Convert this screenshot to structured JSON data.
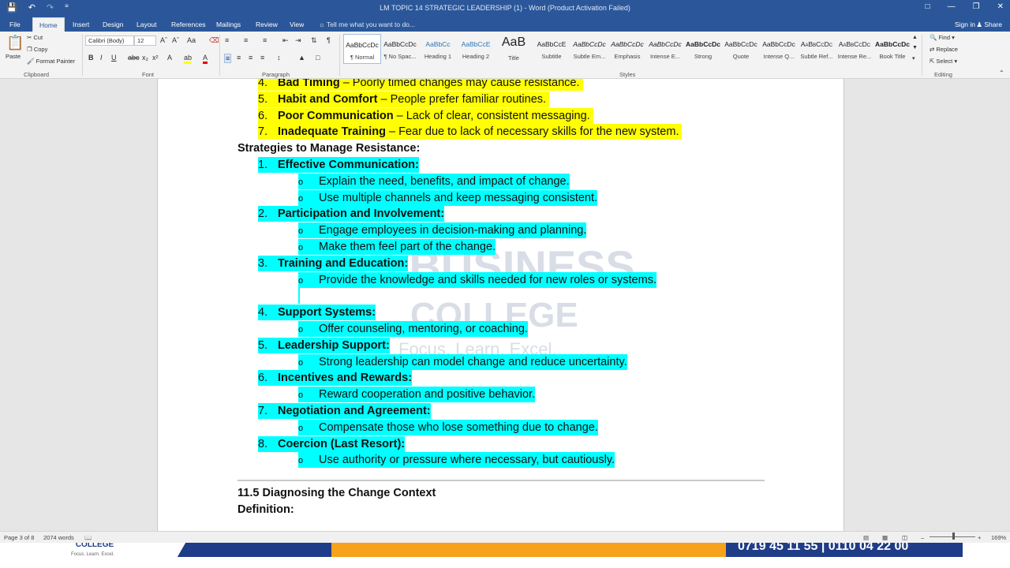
{
  "window": {
    "title": "LM TOPIC 14 STRATEGIC LEADERSHIP (1) - Word (Product Activation Failed)",
    "controls": [
      "ribbon-options-icon",
      "minimize-icon",
      "restore-icon",
      "close-icon"
    ]
  },
  "tabs": [
    {
      "label": "File"
    },
    {
      "label": "Home"
    },
    {
      "label": "Insert"
    },
    {
      "label": "Design"
    },
    {
      "label": "Layout"
    },
    {
      "label": "References"
    },
    {
      "label": "Mailings"
    },
    {
      "label": "Review"
    },
    {
      "label": "View"
    }
  ],
  "tell_me": "Tell me what you want to do...",
  "sign_in": "Sign in",
  "share": "Share",
  "clipboard": {
    "paste": "Paste",
    "cut": "Cut",
    "copy": "Copy",
    "format_painter": "Format Painter",
    "label": "Clipboard"
  },
  "font": {
    "name": "Calibri (Body)",
    "size": "12",
    "label": "Font"
  },
  "paragraph": {
    "label": "Paragraph"
  },
  "styles": {
    "label": "Styles",
    "items": [
      {
        "preview": "AaBbCcDc",
        "name": "¶ Normal"
      },
      {
        "preview": "AaBbCcDc",
        "name": "¶ No Spac..."
      },
      {
        "preview": "AaBbCc",
        "name": "Heading 1"
      },
      {
        "preview": "AaBbCcE",
        "name": "Heading 2"
      },
      {
        "preview": "AaB",
        "name": "Title"
      },
      {
        "preview": "AaBbCcE",
        "name": "Subtitle"
      },
      {
        "preview": "AaBbCcDc",
        "name": "Subtle Em..."
      },
      {
        "preview": "AaBbCcDc",
        "name": "Emphasis"
      },
      {
        "preview": "AaBbCcDc",
        "name": "Intense E..."
      },
      {
        "preview": "AaBbCcDc",
        "name": "Strong"
      },
      {
        "preview": "AaBbCcDc",
        "name": "Quote"
      },
      {
        "preview": "AaBbCcDc",
        "name": "Intense Q..."
      },
      {
        "preview": "AaBbCcDc",
        "name": "Subtle Ref..."
      },
      {
        "preview": "AaBbCcDc",
        "name": "Intense Re..."
      },
      {
        "preview": "AaBbCcDc",
        "name": "Book Title"
      }
    ]
  },
  "editing": {
    "find": "Find",
    "replace": "Replace",
    "select": "Select",
    "label": "Editing"
  },
  "document": {
    "resistance_causes": [
      {
        "num": "4.",
        "term": "Bad Timing",
        "desc": " – Poorly timed changes may cause resistance."
      },
      {
        "num": "5.",
        "term": "Habit and Comfort",
        "desc": " – People prefer familiar routines."
      },
      {
        "num": "6.",
        "term": "Poor Communication",
        "desc": " – Lack of clear, consistent messaging."
      },
      {
        "num": "7.",
        "term": "Inadequate Training",
        "desc": " – Fear due to lack of necessary skills for the new system."
      }
    ],
    "strategies_heading": "Strategies to Manage Resistance:",
    "strategies": [
      {
        "num": "1.",
        "title": "Effective Communication:",
        "points": [
          "Explain the need, benefits, and impact of change.",
          "Use multiple channels and keep messaging consistent."
        ]
      },
      {
        "num": "2.",
        "title": "Participation and Involvement:",
        "points": [
          "Engage employees in decision-making and planning.",
          "Make them feel part of the change."
        ]
      },
      {
        "num": "3.",
        "title": "Training and Education:",
        "points": [
          "Provide the knowledge and skills needed for new roles or systems."
        ]
      },
      {
        "num": "4.",
        "title": "Support Systems:",
        "points": [
          "Offer counseling, mentoring, or coaching."
        ]
      },
      {
        "num": "5.",
        "title": "Leadership Support:",
        "points": [
          "Strong leadership can model change and reduce uncertainty."
        ]
      },
      {
        "num": "6.",
        "title": "Incentives and Rewards:",
        "points": [
          "Reward cooperation and positive behavior."
        ]
      },
      {
        "num": "7.",
        "title": "Negotiation and Agreement:",
        "points": [
          "Compensate those who lose something due to change."
        ]
      },
      {
        "num": "8.",
        "title": "Coercion (Last Resort):",
        "points": [
          "Use authority or pressure where necessary, but cautiously."
        ]
      }
    ],
    "bullet_char": "o",
    "section_heading": "11.5 Diagnosing the Change Context",
    "definition_label": "Definition:",
    "watermark": {
      "line1": "IS BUSINESS",
      "line2": "COLLEGE",
      "line3": "Focus. Learn. Excel."
    }
  },
  "status": {
    "page": "Page 3 of 8",
    "words": "2074 words",
    "zoom": "169%"
  },
  "banner": {
    "college": "COLLEGE",
    "tagline": "Focus. Learn. Excel.",
    "phones": "0719 45 11 55 | 0110 04 22 00"
  },
  "colors": {
    "title_bar": "#2b579a",
    "highlight_yellow": "#ffff00",
    "highlight_cyan": "#00ffff"
  }
}
